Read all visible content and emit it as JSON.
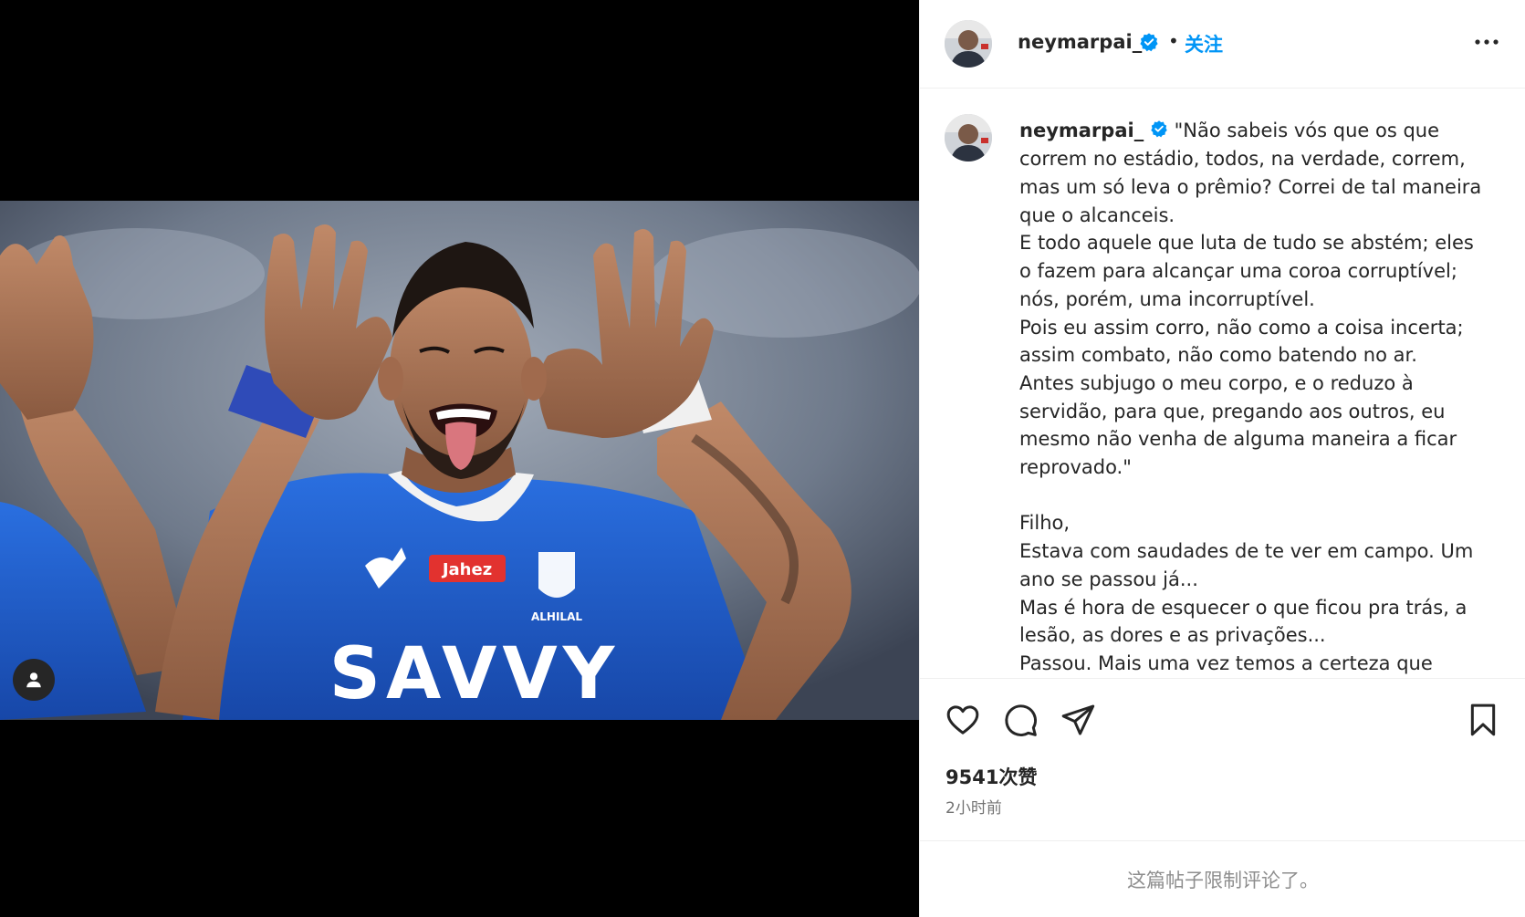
{
  "post": {
    "username": "neymarpai_",
    "follow_label": "关注",
    "separator": "•",
    "caption": "\"Não sabeis vós que os que correm no estádio, todos, na verdade, correm, mas um só leva o prêmio? Correi de tal maneira que o alcanceis.\nE todo aquele que luta de tudo se abstém; eles o fazem para alcançar uma coroa corruptível; nós, porém, uma incorruptível.\nPois eu assim corro, não como a coisa incerta; assim combato, não como batendo no ar.\nAntes subjugo o meu corpo, e o reduzo à servidão, para que, pregando aos outros, eu mesmo não venha de alguma maneira a ficar reprovado.\"\n\nFilho,\nEstava com saudades de te ver em campo. Um ano se passou já...\nMas é hora de esquecer o que ficou pra trás, a lesão, as dores e as privações...\nPassou. Mais uma vez temos a certeza que \"tudo",
    "likes": "9541次赞",
    "time_ago": "2小时前",
    "comments_limited": "这篇帖子限制评论了。"
  },
  "photo": {
    "jersey_sponsor": "SAVVY",
    "chest_sponsor": "Jahez",
    "club_text": "ALHILAL"
  },
  "icons": {
    "verified": "verified-badge-icon",
    "more": "more-options-icon",
    "like": "heart-icon",
    "comment": "comment-icon",
    "share": "send-icon",
    "save": "bookmark-icon",
    "user_tag": "user-tag-icon"
  },
  "colors": {
    "accent": "#0095f6",
    "jersey": "#1f5fd0"
  }
}
